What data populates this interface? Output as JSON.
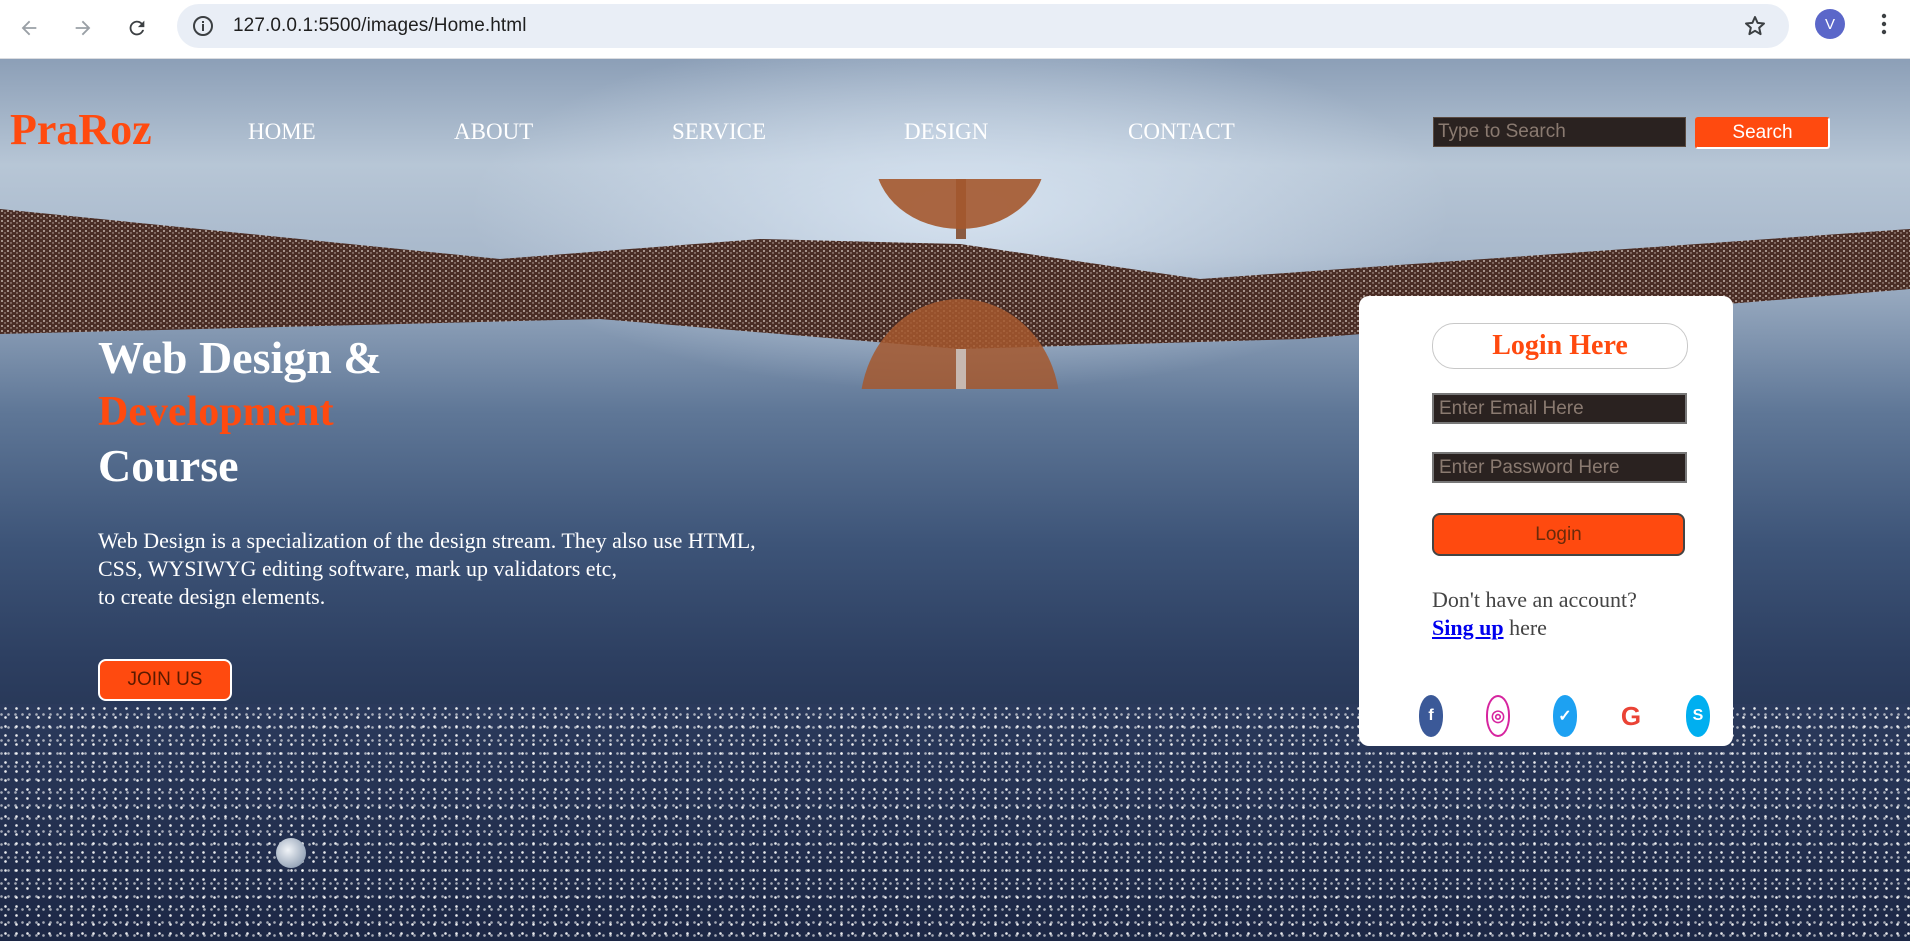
{
  "browser": {
    "url": "127.0.0.1:5500/images/Home.html",
    "profile_initial": "V",
    "icons": [
      "back-arrow-icon",
      "forward-arrow-icon",
      "reload-icon",
      "site-info-icon",
      "bookmark-star-icon",
      "more-options-icon"
    ]
  },
  "header": {
    "logo": "PraRoz",
    "nav": [
      "HOME",
      "ABOUT",
      "SERVICE",
      "DESIGN",
      "CONTACT"
    ],
    "search_placeholder": "Type to Search",
    "search_button": "Search"
  },
  "hero": {
    "title_line1": "Web Design &",
    "title_line2": "Development",
    "title_line3": "Course",
    "description_lines": [
      "Web Design is a specialization of the design stream. They also use HTML,",
      "CSS, WYSIWYG editing software, mark up validators etc,",
      "to create design elements."
    ],
    "join_button": "JOIN US"
  },
  "login": {
    "title": "Login Here",
    "email_placeholder": "Enter Email Here",
    "password_placeholder": "Enter Password Here",
    "login_button": "Login",
    "no_account_text": "Don't have an account?",
    "signup_link": "Sing up",
    "signup_suffix": " here",
    "social": [
      {
        "name": "facebook",
        "glyph": "f",
        "color": "#3b5998"
      },
      {
        "name": "instagram",
        "glyph": "◎",
        "color": "#d6249f"
      },
      {
        "name": "twitter",
        "glyph": "✓",
        "color": "#1da1f2"
      },
      {
        "name": "google",
        "glyph": "G",
        "color": "#ea4335"
      },
      {
        "name": "skype",
        "glyph": "S",
        "color": "#00aff0"
      }
    ]
  },
  "colors": {
    "accent": "#ff4a0f",
    "card_bg": "#ffffff",
    "link": "#0000ee"
  }
}
